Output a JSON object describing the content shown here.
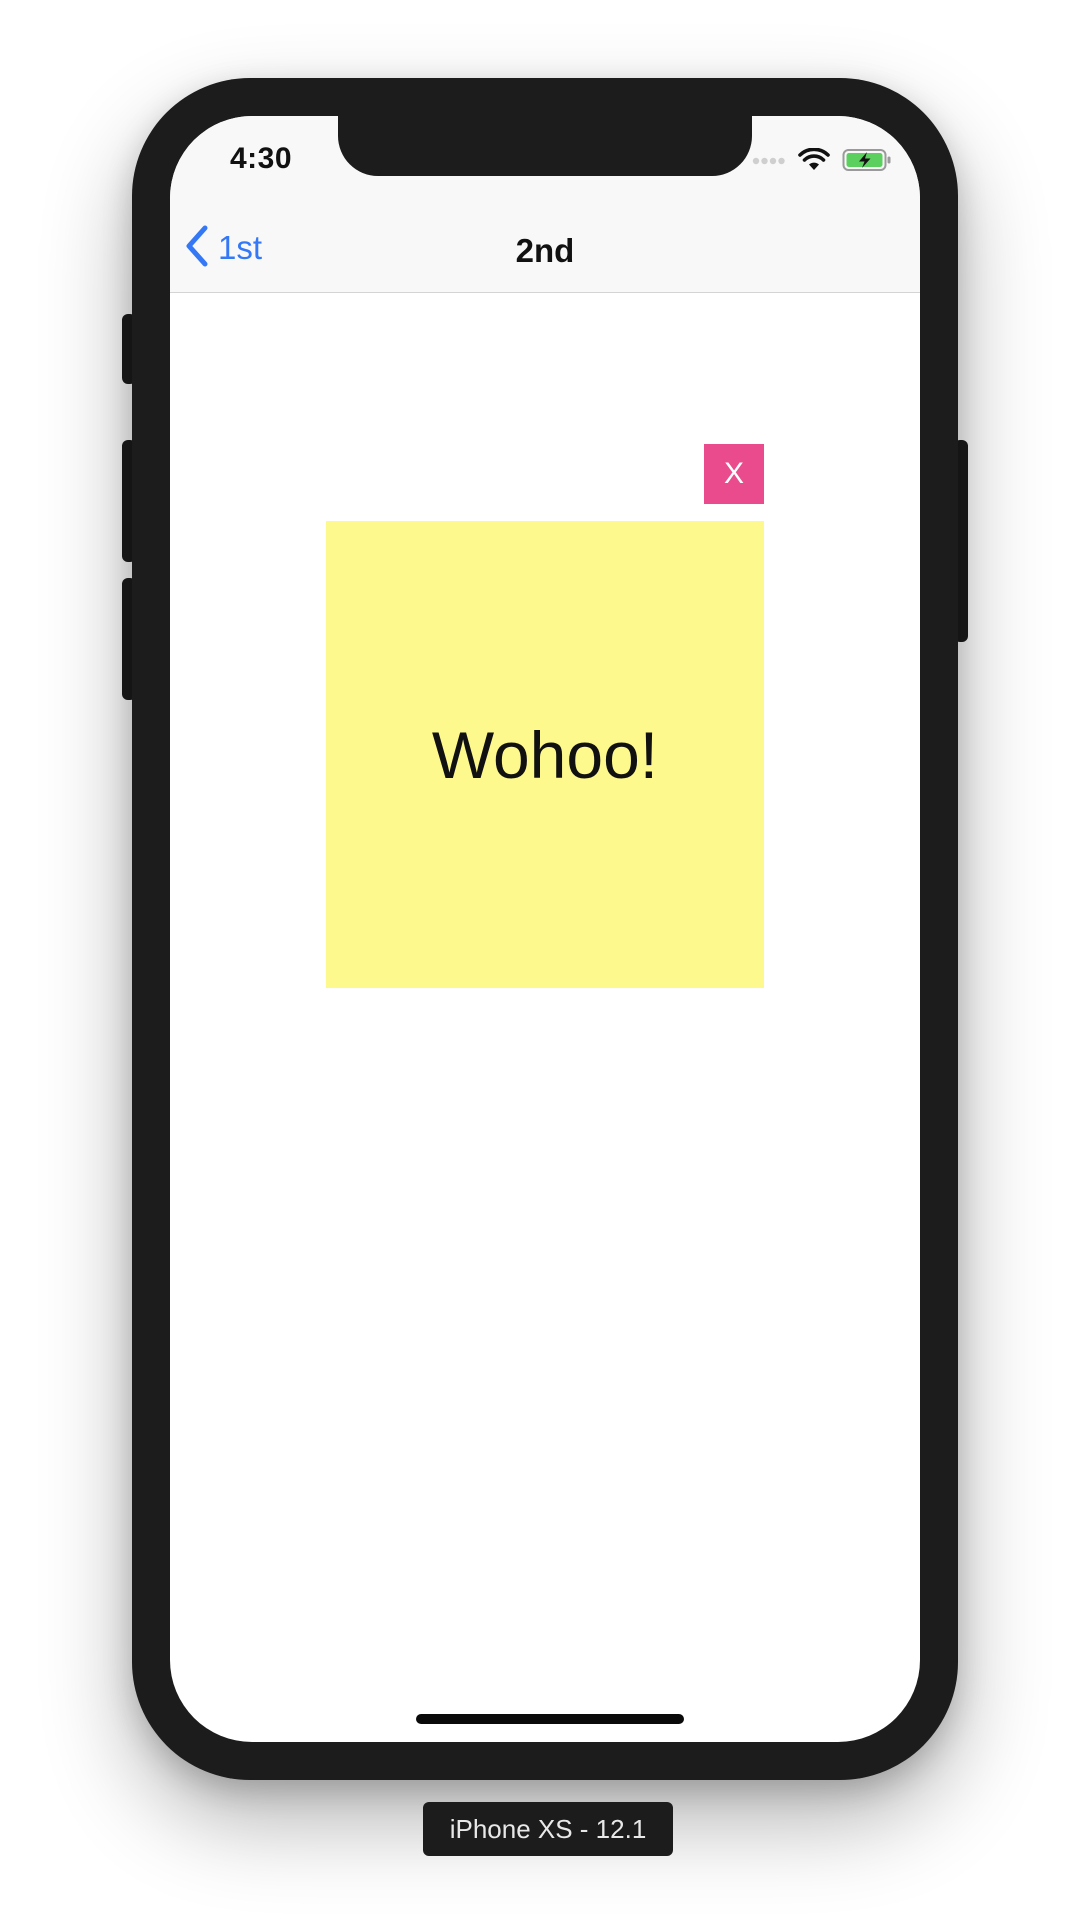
{
  "status_bar": {
    "time": "4:30",
    "icons": [
      "signal-icon",
      "wifi-icon",
      "battery-charging-icon"
    ]
  },
  "nav_bar": {
    "back_label": "1st",
    "title": "2nd"
  },
  "content": {
    "close_label": "X",
    "note_text": "Wohoo!"
  },
  "device_label": "iPhone XS - 12.1",
  "colors": {
    "accent": "#3478f6",
    "close_button": "#ea4b8c",
    "note_background": "#fdf98c",
    "battery_fill": "#5bd05f",
    "device_frame": "#1c1c1c"
  }
}
